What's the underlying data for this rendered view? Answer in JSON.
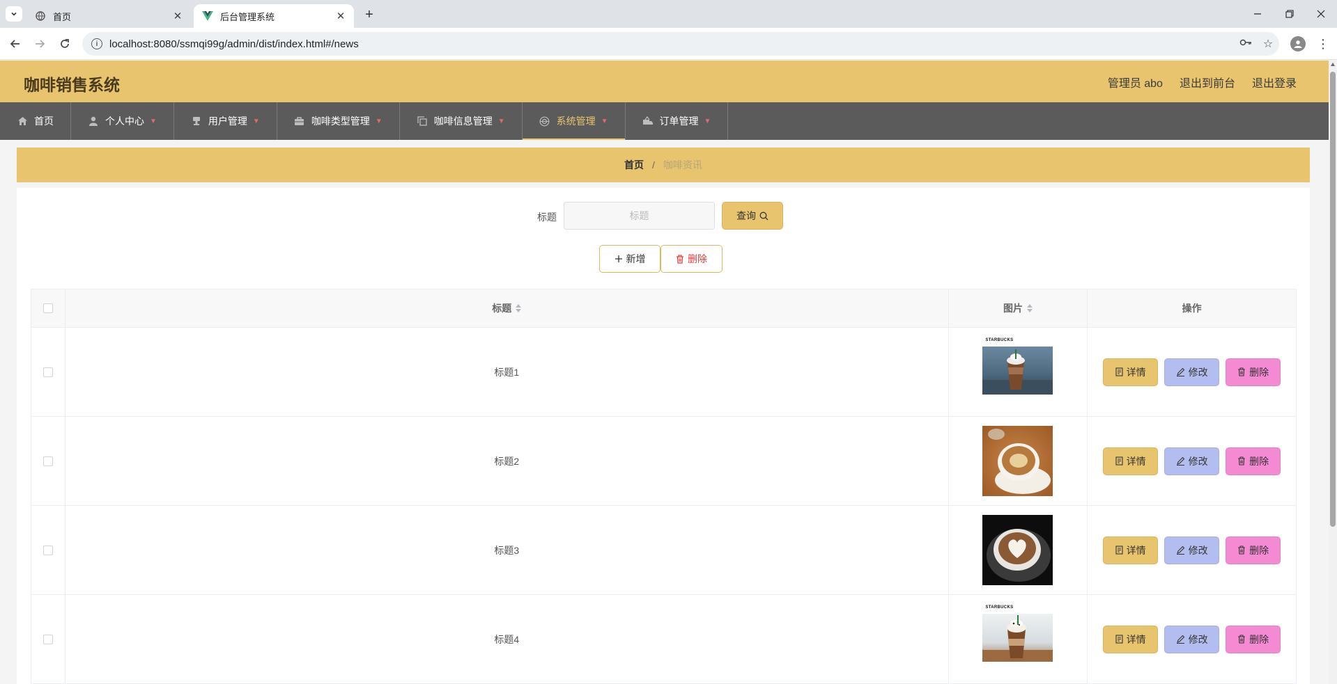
{
  "browser": {
    "tabs": [
      {
        "label": "首页",
        "active": false
      },
      {
        "label": "后台管理系统",
        "active": true
      }
    ],
    "url": "localhost:8080/ssmqi99g/admin/dist/index.html#/news"
  },
  "header": {
    "brand": "咖啡销售系统",
    "admin_label": "管理员 abo",
    "to_front_label": "退出到前台",
    "logout_label": "退出登录"
  },
  "menu": [
    {
      "label": "首页",
      "icon": "home-icon",
      "dropdown": false,
      "active": false
    },
    {
      "label": "个人中心",
      "icon": "user-icon",
      "dropdown": true,
      "active": false
    },
    {
      "label": "用户管理",
      "icon": "stamp-icon",
      "dropdown": true,
      "active": false
    },
    {
      "label": "咖啡类型管理",
      "icon": "briefcase-icon",
      "dropdown": true,
      "active": false
    },
    {
      "label": "咖啡信息管理",
      "icon": "copy-icon",
      "dropdown": true,
      "active": false
    },
    {
      "label": "系统管理",
      "icon": "globe-icon",
      "dropdown": true,
      "active": true
    },
    {
      "label": "订单管理",
      "icon": "truck-icon",
      "dropdown": true,
      "active": false
    }
  ],
  "breadcrumb": {
    "home": "首页",
    "separator": "/",
    "current": "咖啡资讯"
  },
  "search": {
    "label": "标题",
    "placeholder": "标题",
    "value": "",
    "query_label": "查询"
  },
  "actions": {
    "add_label": "新增",
    "delete_label": "删除"
  },
  "table": {
    "columns": {
      "title": "标题",
      "image": "图片",
      "ops": "操作"
    },
    "rows": [
      {
        "title": "标题1",
        "image": "starbucks-frappuccino-photo"
      },
      {
        "title": "标题2",
        "image": "latte-cup-on-wood-photo"
      },
      {
        "title": "标题3",
        "image": "latte-art-heart-photo"
      },
      {
        "title": "标题4",
        "image": "starbucks-mocha-frappuccino-photo"
      }
    ],
    "op_labels": {
      "detail": "详情",
      "edit": "修改",
      "delete": "删除"
    },
    "logo_text": "STARBUCKS"
  },
  "colors": {
    "accent": "#e8c46e",
    "menu_bg": "#5c5b5b",
    "edit_btn": "#b3bdf0",
    "delete_btn": "#f48ad2",
    "danger_text": "#e23c3c"
  }
}
